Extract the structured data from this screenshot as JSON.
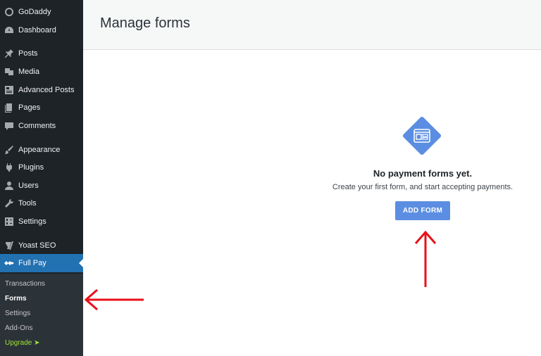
{
  "sidebar": {
    "items": [
      {
        "label": "GoDaddy",
        "icon": "godaddy-logo-icon"
      },
      {
        "label": "Dashboard",
        "icon": "dashboard-icon"
      },
      {
        "label": "Posts",
        "icon": "pin-icon"
      },
      {
        "label": "Media",
        "icon": "media-icon"
      },
      {
        "label": "Advanced Posts",
        "icon": "advanced-posts-icon"
      },
      {
        "label": "Pages",
        "icon": "pages-icon"
      },
      {
        "label": "Comments",
        "icon": "comment-icon"
      },
      {
        "label": "Appearance",
        "icon": "brush-icon"
      },
      {
        "label": "Plugins",
        "icon": "plugin-icon"
      },
      {
        "label": "Users",
        "icon": "user-icon"
      },
      {
        "label": "Tools",
        "icon": "wrench-icon"
      },
      {
        "label": "Settings",
        "icon": "settings-icon"
      },
      {
        "label": "Yoast SEO",
        "icon": "yoast-icon"
      },
      {
        "label": "Full Pay",
        "icon": "fullpay-icon"
      }
    ],
    "submenu": [
      {
        "label": "Transactions"
      },
      {
        "label": "Forms"
      },
      {
        "label": "Settings"
      },
      {
        "label": "Add-Ons"
      },
      {
        "label": "Upgrade ➤"
      }
    ]
  },
  "header": {
    "title": "Manage forms"
  },
  "empty_state": {
    "title": "No payment forms yet.",
    "subtitle": "Create your first form, and start accepting payments.",
    "button_label": "ADD FORM"
  },
  "colors": {
    "sidebar_bg": "#1d2327",
    "active_bg": "#2271b1",
    "accent": "#5b8ee2",
    "upgrade": "#9fe23a",
    "annotation_arrow": "#e8101a"
  }
}
